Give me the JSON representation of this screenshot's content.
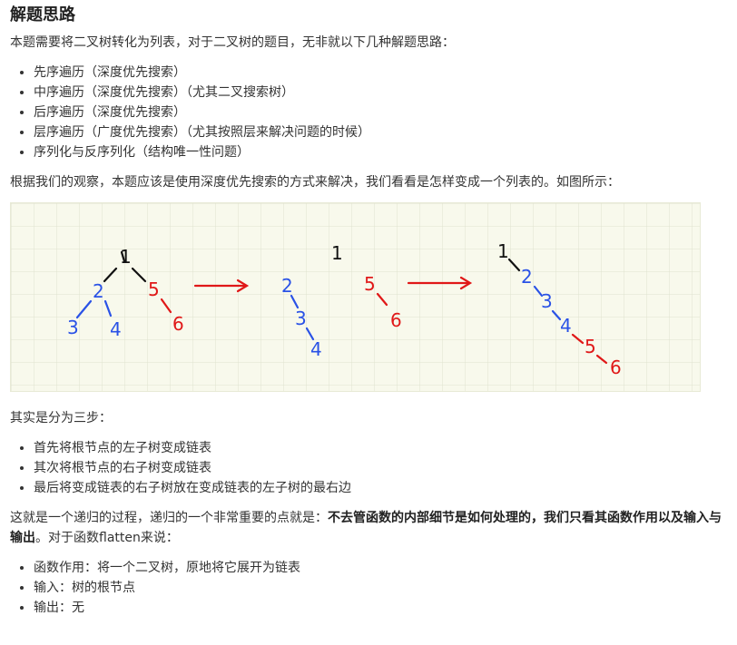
{
  "section": {
    "title": "解题思路",
    "intro": "本题需要将二叉树转化为列表，对于二叉树的题目，无非就以下几种解题思路：",
    "approaches": [
      "先序遍历（深度优先搜索）",
      "中序遍历（深度优先搜索）（尤其二叉搜索树）",
      "后序遍历（深度优先搜索）",
      "层序遍历（广度优先搜索）（尤其按照层来解决问题的时候）",
      "序列化与反序列化（结构唯一性问题）"
    ],
    "observation": "根据我们的观察，本题应该是使用深度优先搜索的方式来解决，我们看看是怎样变成一个列表的。如图所示：",
    "steps_intro": "其实是分为三步：",
    "steps": [
      "首先将根节点的左子树变成链表",
      "其次将根节点的右子树变成链表",
      "最后将变成链表的右子树放在变成链表的左子树的最右边"
    ],
    "recursion_pre": "这就是一个递归的过程，递归的一个非常重要的点就是：",
    "recursion_bold": "不去管函数的内部细节是如何处理的，我们只看其函数作用以及输入与输出",
    "recursion_post": "。对于函数flatten来说：",
    "flatten_points": [
      "函数作用：将一个二叉树，原地将它展开为链表",
      "输入：树的根节点",
      "输出：无"
    ]
  },
  "figure": {
    "node_labels": {
      "root": "1",
      "n2": "2",
      "n3": "3",
      "n4": "4",
      "n5": "5",
      "n6": "6"
    },
    "colors": {
      "paper": "#f8f9ec",
      "grid": "#dfe3cf",
      "black": "#111111",
      "blue": "#2a52e6",
      "red": "#e01818"
    }
  }
}
